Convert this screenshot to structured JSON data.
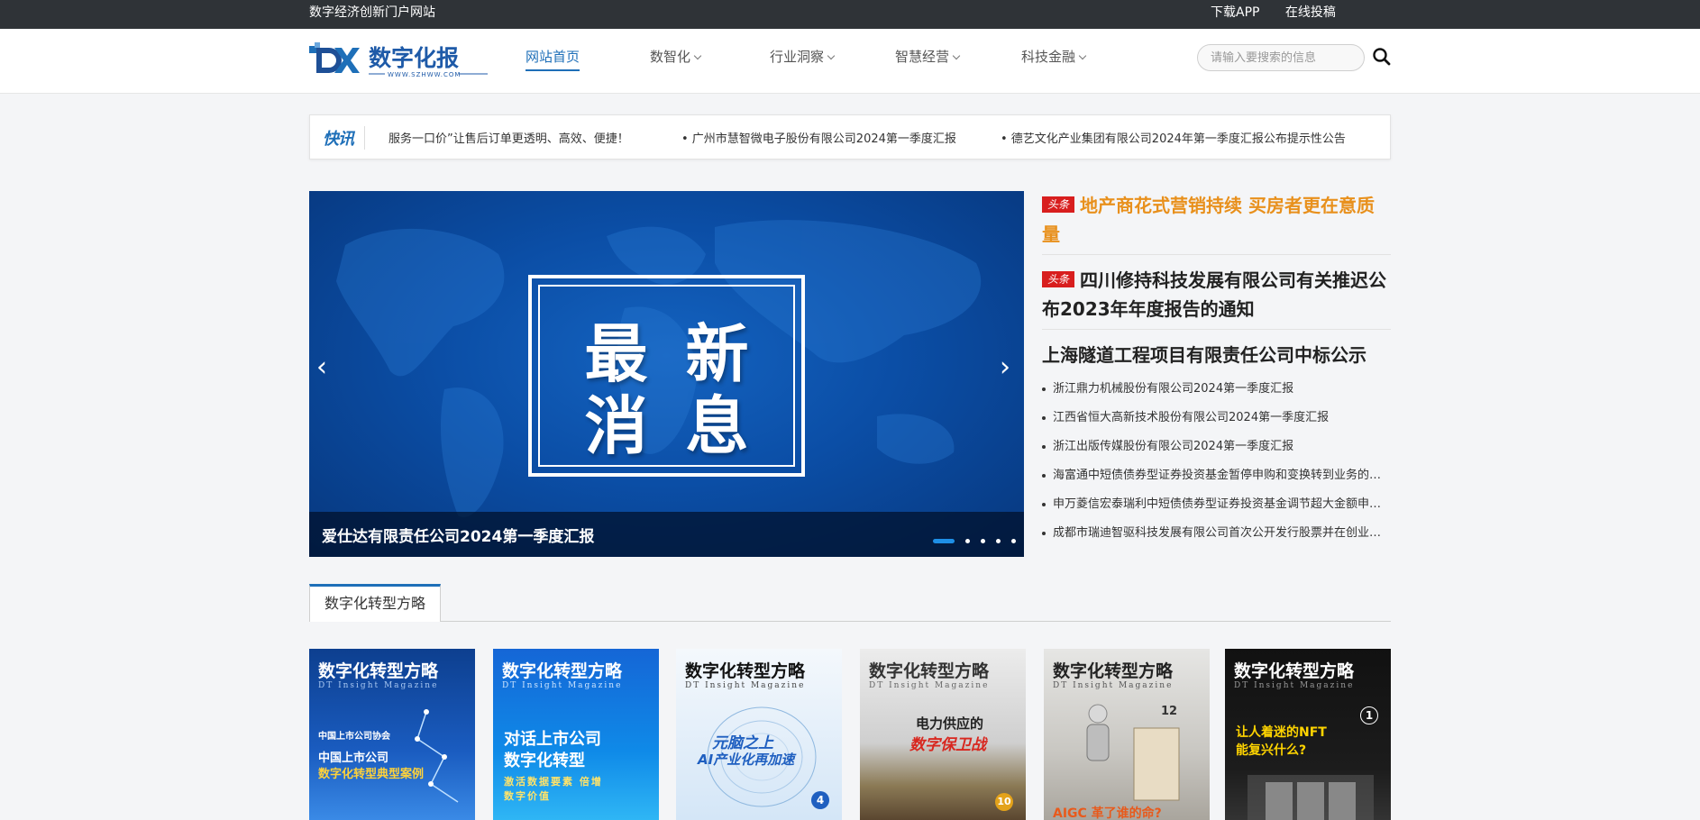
{
  "topbar": {
    "slogan": "数字经济创新门户网站",
    "download": "下载APP",
    "submit": "在线投稿"
  },
  "logo": {
    "name": "数字化报",
    "url_text": "WWW.SZHWW.COM"
  },
  "nav": {
    "home": "网站首页",
    "digital": "数智化",
    "industry": "行业洞察",
    "operation": "智慧经营",
    "fintech": "科技金融"
  },
  "search": {
    "placeholder": "请输入要搜索的信息"
  },
  "ticker": {
    "tag": "快讯",
    "items": [
      "服务一口价”让售后订单更透明、高效、便捷！",
      "• 广州市慧智微电子股份有限公司2024第一季度汇报",
      "• 德艺文化产业集团有限公司2024年第一季度汇报公布提示性公告"
    ]
  },
  "banner": {
    "line1": "最新",
    "line2": "消息",
    "caption": "爱仕达有限责任公司2024第一季度汇报",
    "prev": "‹",
    "next": "›"
  },
  "headlines": {
    "badge": "头条",
    "h1": "地产商花式营销持续 买房者更在意质量",
    "h2": "四川修持科技发展有限公司有关推迟公布2023年年度报告的通知",
    "h3": "上海隧道工程项目有限责任公司中标公示",
    "list": [
      "浙江鼎力机械股份有限公司2024第一季度汇报",
      "江西省恒大高新技术股份有限公司2024第一季度汇报",
      "浙江出版传媒股份有限公司2024第一季度汇报",
      "海富通中短债债券型证券投资基金暂停申购和变换转到业务的公告",
      "申万菱信宏泰瑞利中短债债券型证券投资基金调节超大金额申购的公告",
      "成都市瑞迪智驱科技发展有限公司首次公开发行股票并在创业板上市发行公告"
    ]
  },
  "section": {
    "title": "数字化转型方略"
  },
  "covers": [
    {
      "title": "数字化转型方略",
      "sub": "DT Insight Magazine",
      "l1": "中国上市公司协会",
      "l2": "中国上市公司",
      "l3": "数字化转型典型案例"
    },
    {
      "title": "数字化转型方略",
      "sub": "DT Insight Magazine",
      "l1": "对话上市公司",
      "l2": "数字化转型",
      "l3": "激活数据要素 倍增数字价值"
    },
    {
      "title": "数字化转型方略",
      "sub": "DT Insight Magazine",
      "l1": "元脑之上",
      "l2": "AI产业化再加速",
      "num": "4"
    },
    {
      "title": "数字化转型方略",
      "sub": "DT Insight Magazine",
      "l1": "电力供应的",
      "l2": "数字保卫战",
      "num": "10"
    },
    {
      "title": "数字化转型方略",
      "sub": "DT Insight Magazine",
      "l1": "AIGC 革了谁的命?",
      "num": "12"
    },
    {
      "title": "数字化转型方略",
      "sub": "DT Insight Magazine",
      "l1": "让人着迷的NFT",
      "l2": "能复兴什么?",
      "num": "1"
    }
  ]
}
